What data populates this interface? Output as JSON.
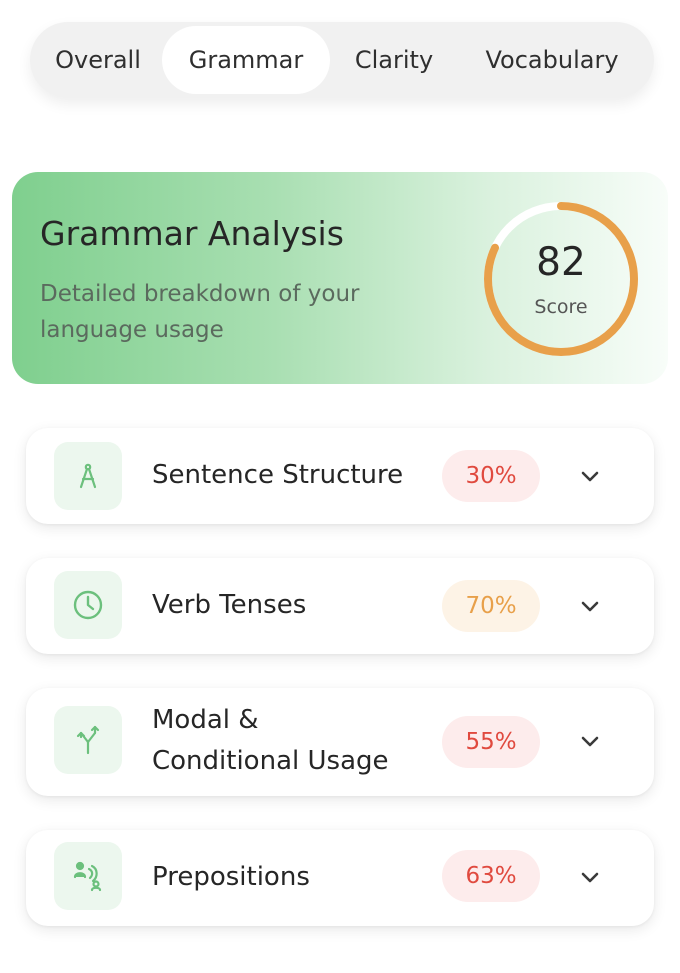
{
  "tabs": [
    {
      "label": "Overall"
    },
    {
      "label": "Grammar",
      "active": true
    },
    {
      "label": "Clarity"
    },
    {
      "label": "Vocabulary"
    }
  ],
  "hero": {
    "title": "Grammar Analysis",
    "subtitle": "Detailed breakdown of your language usage",
    "score": "82",
    "score_label": "Score",
    "score_fraction": 0.82,
    "ring_color": "#e8a04a",
    "ring_track_color": "#ffffff"
  },
  "categories": [
    {
      "label": "Sentence Structure",
      "percent": "30%",
      "badge_bg": "#fdecec",
      "badge_fg": "#e04a3f",
      "icon": "compass-icon"
    },
    {
      "label": "Verb Tenses",
      "percent": "70%",
      "badge_bg": "#fdf3e6",
      "badge_fg": "#e8a04a",
      "icon": "clock-icon"
    },
    {
      "label_line1": "Modal &",
      "label_line2": "Conditional Usage",
      "percent": "55%",
      "badge_bg": "#fdecec",
      "badge_fg": "#e04a3f",
      "icon": "split-arrows-icon"
    },
    {
      "label": "Prepositions",
      "percent": "63%",
      "badge_bg": "#fdecec",
      "badge_fg": "#e04a3f",
      "icon": "speech-icon"
    }
  ],
  "colors": {
    "accent_green": "#6cc07d",
    "chevron": "#3a3a3a"
  }
}
